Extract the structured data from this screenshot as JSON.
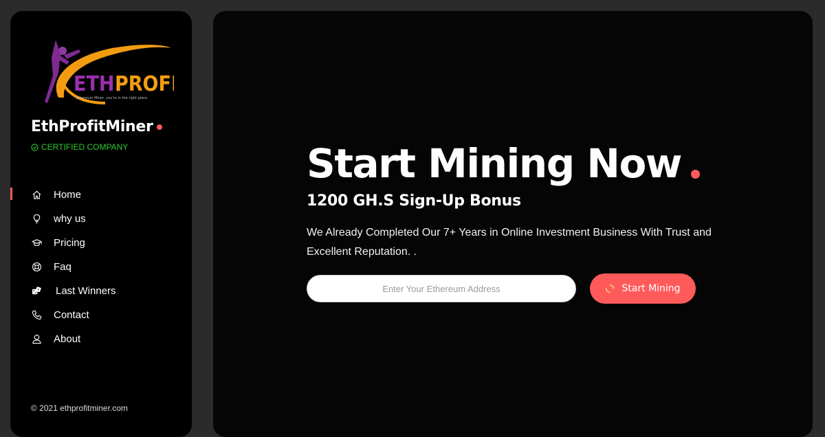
{
  "colors": {
    "accent": "#ff5a5a",
    "certified": "#2ecc2e",
    "sidebar_bg": "#000000",
    "main_bg": "#050505",
    "page_bg": "#2b2b2b"
  },
  "logo": {
    "text_eth": "ETH",
    "text_profit": "PROFIT",
    "tagline": "Ethereum Miner, you're in the right place"
  },
  "sidebar": {
    "brand": "EthProfitMiner",
    "certified": "CERTIFIED COMPANY",
    "items": [
      {
        "label": "Home",
        "icon": "home-icon",
        "active": true
      },
      {
        "label": "why us",
        "icon": "lightbulb-icon",
        "active": false
      },
      {
        "label": "Pricing",
        "icon": "graduation-cap-icon",
        "active": false
      },
      {
        "label": "Faq",
        "icon": "lifebuoy-icon",
        "active": false
      },
      {
        "label": "Last Winners",
        "icon": "dice-icon",
        "active": false
      },
      {
        "label": "Contact",
        "icon": "phone-icon",
        "active": false
      },
      {
        "label": "About",
        "icon": "user-icon",
        "active": false
      }
    ],
    "copyright": "© 2021 ethprofitminer.com"
  },
  "hero": {
    "title": "Start Mining Now",
    "subtitle": "1200 GH.S Sign-Up Bonus",
    "description": "We Already Completed Our 7+ Years in Online Investment Business With Trust and Excellent Reputation. .",
    "input_placeholder": "Enter Your Ethereum Address",
    "input_value": "",
    "button_label": "Start Mining",
    "button_icon": "spinner-icon"
  }
}
